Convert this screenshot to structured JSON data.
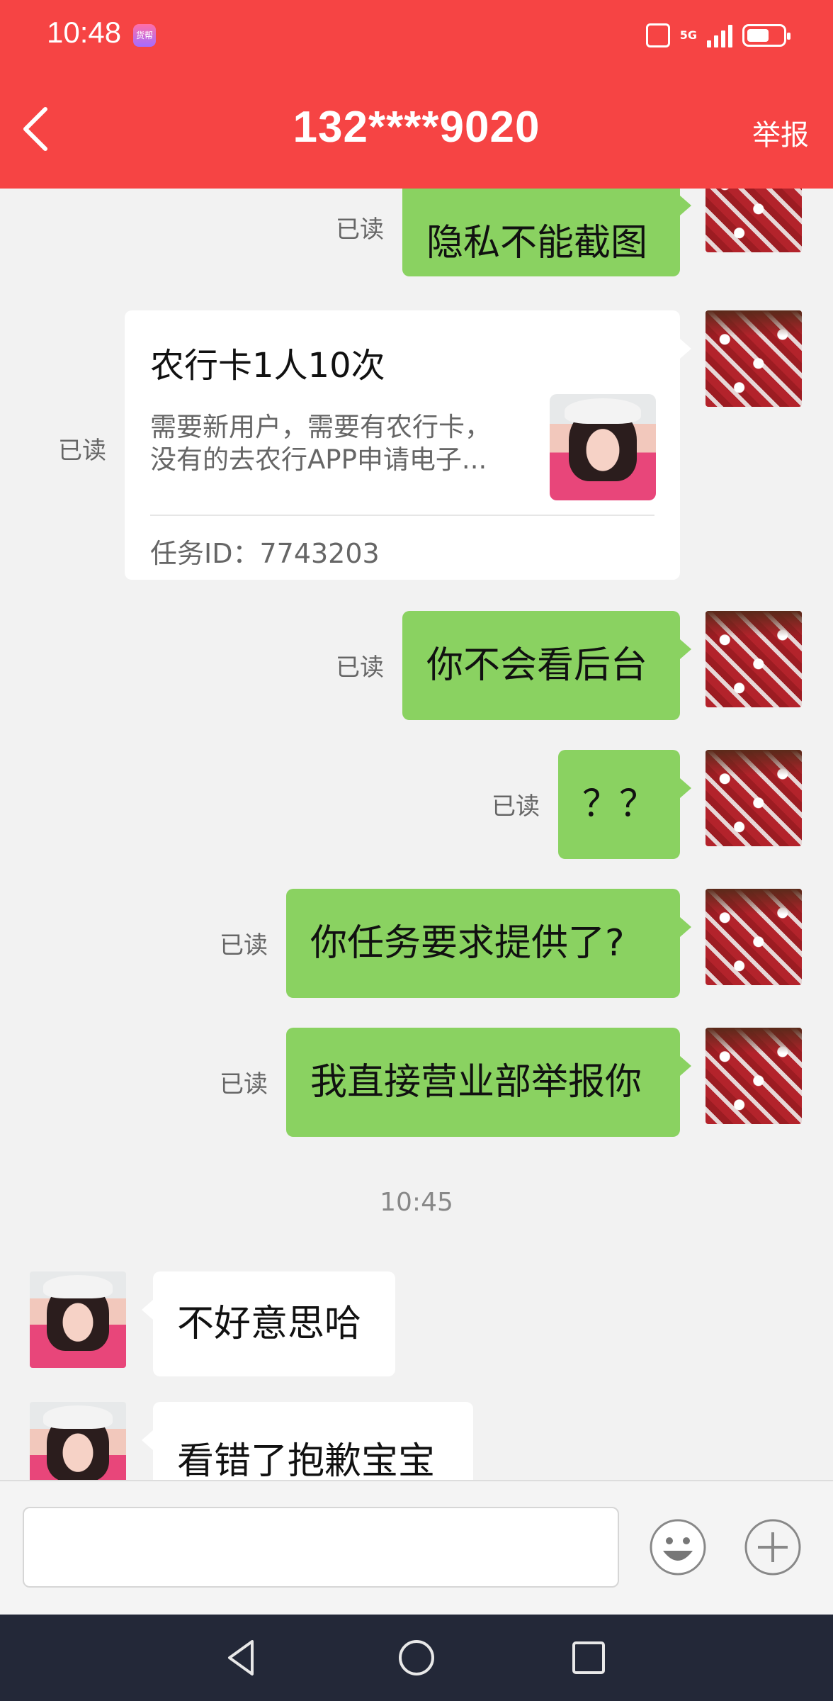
{
  "status_bar": {
    "time": "10:48",
    "app_badge": "货帮",
    "network": "5G",
    "icons": [
      "vibrate-icon",
      "signal-icon",
      "battery-icon"
    ]
  },
  "header": {
    "title": "132****9020",
    "back_icon": "chevron-left-icon",
    "report_label": "举报",
    "background": "#f64444"
  },
  "colors": {
    "my_bubble": "#8ad261",
    "their_bubble": "#ffffff",
    "chat_bg": "#f2f2f2"
  },
  "messages": [
    {
      "side": "me",
      "text": "隐私不能截图",
      "status": "已读"
    },
    {
      "side": "me",
      "type": "task-card",
      "status": "已读",
      "card": {
        "title": "农行卡1人10次",
        "desc_line1": "需要新用户，需要有农行卡，",
        "desc_line2": "没有的去农行APP申请电子...",
        "task_id": "任务ID：7743203"
      }
    },
    {
      "side": "me",
      "text": "你不会看后台",
      "status": "已读"
    },
    {
      "side": "me",
      "text": "？？",
      "status": "已读"
    },
    {
      "side": "me",
      "text": "你任务要求提供了?",
      "status": "已读"
    },
    {
      "side": "me",
      "text": "我直接营业部举报你",
      "status": "已读"
    },
    {
      "type": "timestamp",
      "text": "10:45"
    },
    {
      "side": "them",
      "text": "不好意思哈"
    },
    {
      "side": "them",
      "text": "看错了抱歉宝宝"
    }
  ],
  "input_bar": {
    "placeholder": "",
    "emoji_icon": "emoji-icon",
    "plus_icon": "plus-icon"
  },
  "nav_bar": {
    "icons": [
      "back-triangle-icon",
      "home-circle-icon",
      "recents-square-icon"
    ]
  }
}
